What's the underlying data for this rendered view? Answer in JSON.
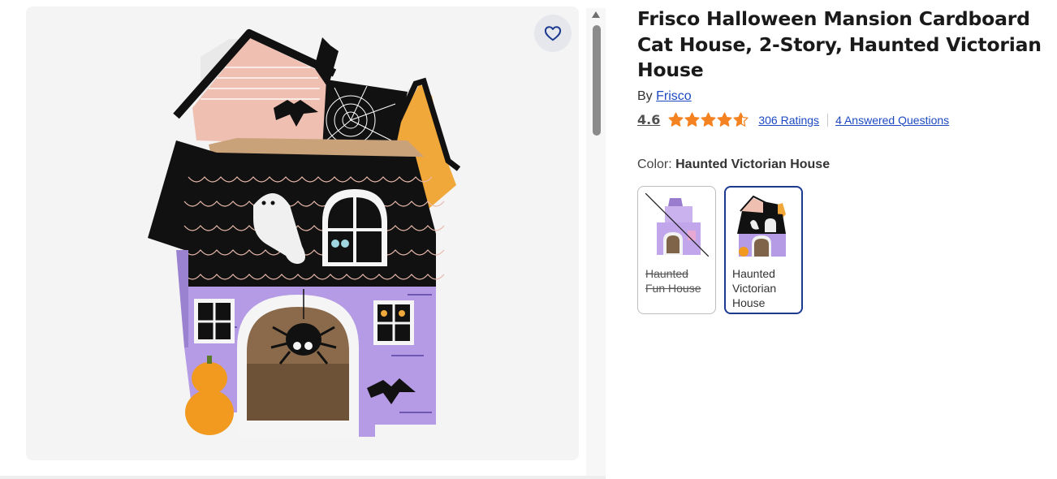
{
  "product": {
    "title": "Frisco Halloween Mansion Cardboard Cat House, 2-Story, Haunted Victorian House",
    "by_prefix": "By ",
    "brand": "Frisco",
    "rating": "4.6",
    "rating_stars": 4.6,
    "ratings_count_text": "306 Ratings",
    "questions_text": "4 Answered Questions"
  },
  "image": {
    "alt": "Frisco Halloween Mansion Cardboard Cat House, Haunted Victorian House",
    "favorite_icon": "heart-icon"
  },
  "color": {
    "label": "Color: ",
    "selected": "Haunted Victorian House",
    "options": [
      {
        "label": "Haunted Fun House",
        "available": false,
        "selected": false
      },
      {
        "label": "Haunted Victorian House",
        "available": true,
        "selected": true
      }
    ]
  },
  "colors": {
    "accent": "#1c49c2",
    "star": "#f58220",
    "selected_border": "#1c3a8f"
  }
}
